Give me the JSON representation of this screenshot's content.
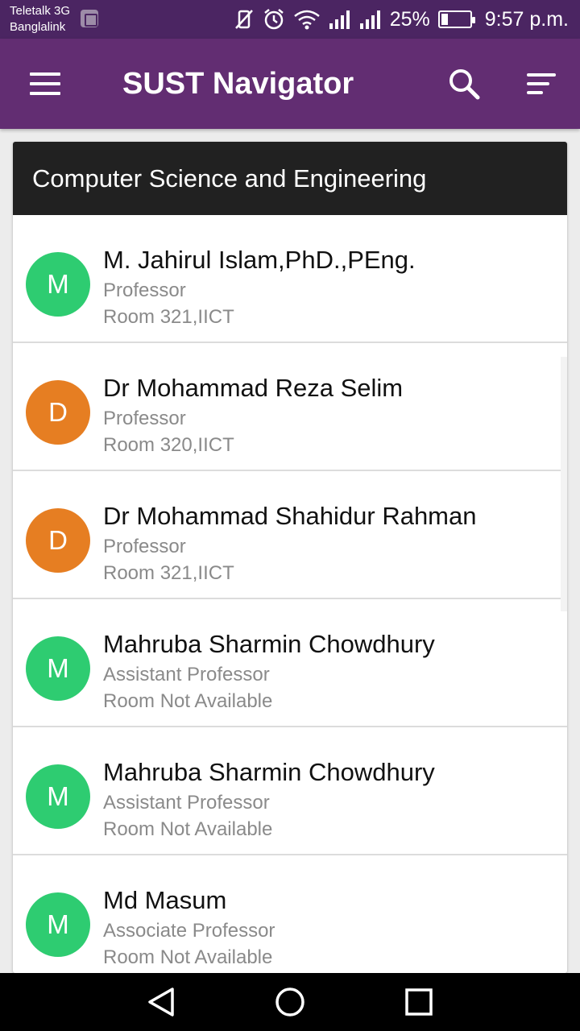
{
  "status_bar": {
    "carrier_1": "Teletalk 3G",
    "carrier_2": "Banglalink",
    "battery_percent": "25%",
    "battery_level": 0.25,
    "time": "9:57 p.m.",
    "icons": [
      "image-icon",
      "vibrate-off-icon",
      "alarm-icon",
      "wifi-icon",
      "signal-icon",
      "signal-icon",
      "battery-icon"
    ]
  },
  "app_bar": {
    "title": "SUST Navigator",
    "background": "#622d72",
    "icons": [
      "menu-icon",
      "search-icon",
      "sort-icon"
    ]
  },
  "department": {
    "title": "Computer Science and Engineering"
  },
  "faculty": [
    {
      "initial": "M",
      "name": "M. Jahirul Islam,PhD.,PEng.",
      "role": "Professor",
      "room": "Room 321,IICT",
      "color": "#2ecc71"
    },
    {
      "initial": "D",
      "name": "Dr Mohammad Reza Selim",
      "role": "Professor",
      "room": "Room 320,IICT",
      "color": "#e67e22"
    },
    {
      "initial": "D",
      "name": "Dr Mohammad Shahidur Rahman",
      "role": "Professor",
      "room": "Room 321,IICT",
      "color": "#e67e22"
    },
    {
      "initial": "M",
      "name": "Mahruba Sharmin Chowdhury",
      "role": "Assistant Professor",
      "room": "Room Not Available",
      "color": "#2ecc71"
    },
    {
      "initial": "M",
      "name": "Mahruba Sharmin Chowdhury",
      "role": "Assistant Professor",
      "room": "Room Not Available",
      "color": "#2ecc71"
    },
    {
      "initial": "M",
      "name": "Md Masum",
      "role": "Associate Professor",
      "room": "Room Not Available",
      "color": "#2ecc71"
    }
  ],
  "nav_bar": {
    "icons": [
      "back-icon",
      "home-icon",
      "recent-apps-icon"
    ]
  }
}
